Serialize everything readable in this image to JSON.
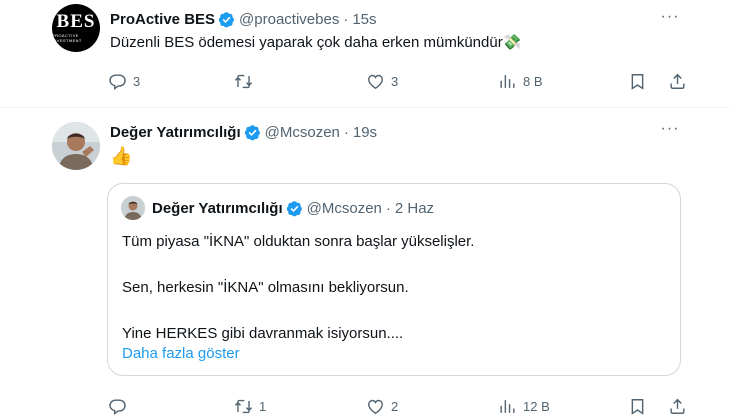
{
  "tweets": [
    {
      "author_name": "ProActive BES",
      "handle": "@proactivebes",
      "separator": "·",
      "time": "15s",
      "avatar_logo_text": "BES",
      "avatar_logo_subtext": "PROACTIVE INVESTMENT",
      "text": "Düzenli BES ödemesi yaparak çok daha erken mümkündür💸",
      "reply_count": "3",
      "retweet_count": "",
      "like_count": "3",
      "view_count": "8 B"
    },
    {
      "author_name": "Değer Yatırımcılığı",
      "handle": "@Mcsozen",
      "separator": "·",
      "time": "19s",
      "text": "👍",
      "reply_count": "",
      "retweet_count": "1",
      "like_count": "2",
      "view_count": "12 B",
      "quote": {
        "author_name": "Değer Yatırımcılığı",
        "handle": "@Mcsozen",
        "separator": "·",
        "time": "2 Haz",
        "line1": "Tüm piyasa \"İKNA\" olduktan sonra başlar yükselişler.",
        "line2": "Sen, herkesin \"İKNA\" olmasını bekliyorsun.",
        "line3": "Yine HERKES gibi davranmak isiyorsun....",
        "show_more": "Daha fazla göster"
      }
    }
  ],
  "more_menu_glyph": "···",
  "colors": {
    "verified": "#1d9bf0",
    "link": "#1d9bf0",
    "secondary_text": "#536471",
    "border": "#cfd9de"
  },
  "icons": [
    "verified-badge-icon",
    "more-icon",
    "reply-icon",
    "retweet-icon",
    "like-icon",
    "views-icon",
    "bookmark-icon",
    "share-icon"
  ]
}
